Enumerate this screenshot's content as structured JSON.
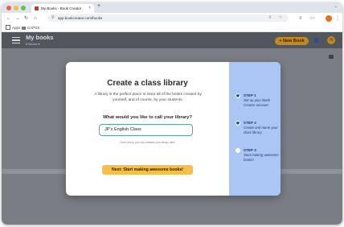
{
  "browser": {
    "tab_title": "My Books - Book Creator",
    "tab_close": "×",
    "new_tab": "+",
    "tab_menu": "⌄",
    "url": "app.bookcreator.com/books",
    "bookmarks": [
      {
        "label": "Apps",
        "icon": "apps-grid-icon"
      },
      {
        "label": "CAPSS",
        "icon": "folder-icon"
      }
    ],
    "colors": {
      "traffic_red": "#ee5f57",
      "traffic_yellow": "#f5bd4f",
      "traffic_green": "#5fc454",
      "profile": "#e8711a"
    }
  },
  "app": {
    "title": "My books",
    "subtitle": "6 Books ▾",
    "new_book_label": "+ New Book",
    "avatar_initial": "N",
    "colors": {
      "accent": "#c4891d",
      "header": "#52565d",
      "overlay": "#7a7d84"
    }
  },
  "modal": {
    "title": "Create a class library",
    "description": "A library is the perfect place to store all of the books created by yourself, and of course, by your students.",
    "question": "What would you like to call your library?",
    "input_value": "JP's English Class",
    "hint": "Don't worry, you can rename your library later",
    "next_button": "Next: Start making awesome books!",
    "steps": [
      {
        "label": "STEP 1",
        "text": "Set up your Book Creator account",
        "status": "done"
      },
      {
        "label": "STEP 2",
        "text": "Create and name your class library",
        "status": "current"
      },
      {
        "label": "STEP 3",
        "text": "Start making awesome books!",
        "status": "todo"
      }
    ],
    "colors": {
      "button": "#f5bf4a",
      "steps_panel": "#abc5f4",
      "input_border": "#5a9ad2"
    }
  }
}
